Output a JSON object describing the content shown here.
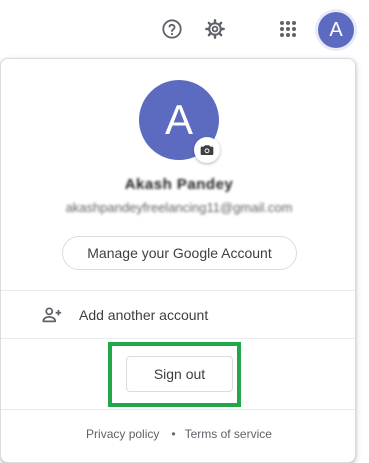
{
  "header": {
    "icons": [
      "help-icon",
      "settings-icon",
      "apps-icon"
    ],
    "avatar_letter": "A",
    "avatar_color": "#5c6bc0"
  },
  "account": {
    "avatar_letter": "A",
    "avatar_color": "#5c6bc0",
    "name": "Akash Pandey",
    "email": "akashpandeyfreelancing11@gmail.com",
    "manage_label": "Manage your Google Account"
  },
  "menu": {
    "add_account_label": "Add another account",
    "sign_out_label": "Sign out",
    "highlight_color": "#22a84a"
  },
  "footer": {
    "privacy_label": "Privacy policy",
    "separator": "•",
    "terms_label": "Terms of service"
  }
}
